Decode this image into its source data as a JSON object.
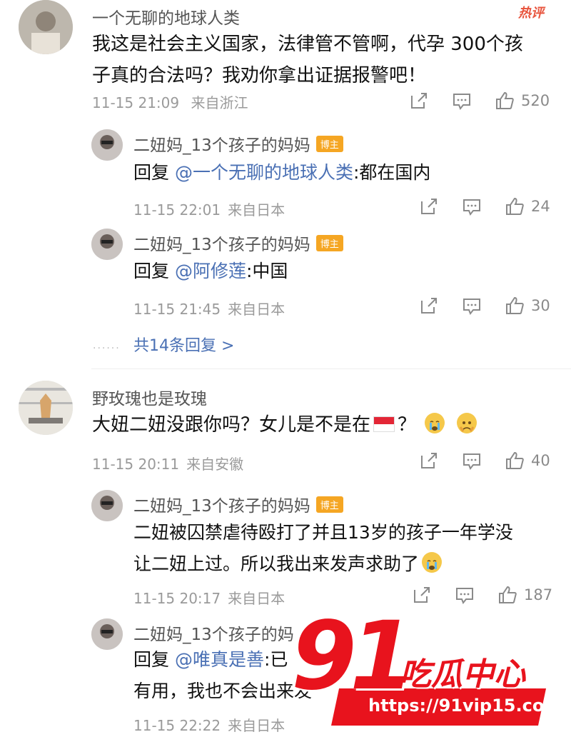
{
  "hot_label": "热评",
  "comments": [
    {
      "user": "一个无聊的地球人类",
      "text_line1": "我这是社会主义国家，法律管不管啊，代孕 300个孩",
      "text_line2": "子真的合法吗？我劝你拿出证据报警吧！",
      "time": "11-15 21:09",
      "location": "来自浙江",
      "likes": "520"
    },
    {
      "user": "野玫瑰也是玫瑰",
      "text_a": "大妞二妞没跟你吗？女儿是不是在",
      "text_b": "？",
      "time": "11-15 20:11",
      "location": "来自安徽",
      "likes": "40"
    }
  ],
  "replies": [
    {
      "user": "二妞妈_13个孩子的妈妈",
      "badge": "博主",
      "prefix": "回复 ",
      "mention": "@一个无聊的地球人类",
      "text": ":都在国内",
      "time": "11-15 22:01",
      "location": "来自日本",
      "likes": "24"
    },
    {
      "user": "二妞妈_13个孩子的妈妈",
      "badge": "博主",
      "prefix": "回复 ",
      "mention": "@阿修莲",
      "text": ":中国",
      "time": "11-15 21:45",
      "location": "来自日本",
      "likes": "30"
    },
    {
      "user": "二妞妈_13个孩子的妈妈",
      "badge": "博主",
      "text_line1": "二妞被囚禁虐待殴打了并且13岁的孩子一年学没",
      "text_line2": "让二妞上过。所以我出来发声求助了",
      "time": "11-15 20:17",
      "location": "来自日本",
      "likes": "187"
    },
    {
      "user": "二妞妈_13个孩子的妈",
      "prefix": "回复 ",
      "mention": "@唯真是善",
      "text": ":已",
      "text_line2": "有用，我也不会出来发",
      "time": "11-15 22:22",
      "location": "来自日本"
    }
  ],
  "more_replies": "共14条回复 >",
  "watermark": {
    "number": "91",
    "title": "吃瓜中心",
    "url": "https://91vip15.com"
  }
}
